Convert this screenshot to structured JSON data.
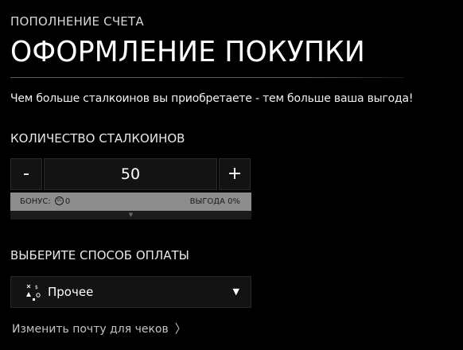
{
  "header": {
    "subtitle": "ПОПОЛНЕНИЕ СЧЕТА",
    "title": "ОФОРМЛЕНИЕ ПОКУПКИ"
  },
  "tagline": "Чем больше сталкоинов вы приобретаете - тем больше ваша выгода!",
  "quantity": {
    "label": "КОЛИЧЕСТВО СТАЛКОИНОВ",
    "minus_label": "-",
    "value": "50",
    "plus_label": "+"
  },
  "bonus": {
    "label": "БОНУС:",
    "coin_symbol": "SC",
    "amount": "0",
    "benefit": "ВЫГОДА 0%",
    "expand_glyph": "▼"
  },
  "payment": {
    "label": "ВЫБЕРИТЕ СПОСОБ ОПЛАТЫ",
    "selected": "Прочее",
    "caret": "▼",
    "icon": "misc-payment-icon"
  },
  "email_link": {
    "label": "Изменить почту для чеков",
    "chevron": "〉"
  },
  "colors": {
    "background": "#000000",
    "bonus_bar": "#8d8d8d",
    "input_bg": "#131313"
  }
}
